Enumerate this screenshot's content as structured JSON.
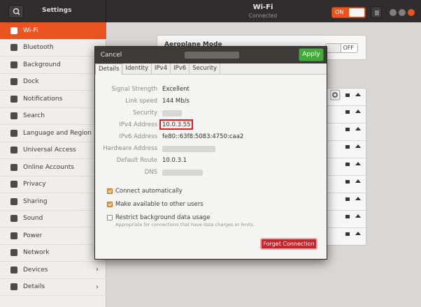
{
  "header": {
    "app_title": "Settings",
    "window_title": "Wi-Fi",
    "window_subtitle": "Connected",
    "wifi_toggle_label": "ON",
    "accent": "#e95420"
  },
  "sidebar": {
    "items": [
      {
        "label": "Wi-Fi",
        "icon": "wifi-icon",
        "active": true
      },
      {
        "label": "Bluetooth",
        "icon": "bluetooth-icon"
      },
      {
        "label": "Background",
        "icon": "background-icon"
      },
      {
        "label": "Dock",
        "icon": "dock-icon"
      },
      {
        "label": "Notifications",
        "icon": "bell-icon"
      },
      {
        "label": "Search",
        "icon": "search-icon"
      },
      {
        "label": "Language and Region",
        "icon": "language-icon"
      },
      {
        "label": "Universal Access",
        "icon": "accessibility-icon"
      },
      {
        "label": "Online Accounts",
        "icon": "cloud-icon"
      },
      {
        "label": "Privacy",
        "icon": "hand-icon"
      },
      {
        "label": "Sharing",
        "icon": "share-icon"
      },
      {
        "label": "Sound",
        "icon": "speaker-icon"
      },
      {
        "label": "Power",
        "icon": "power-icon"
      },
      {
        "label": "Network",
        "icon": "network-icon"
      },
      {
        "label": "Devices",
        "icon": "devices-icon",
        "chevron": "›"
      },
      {
        "label": "Details",
        "icon": "info-icon",
        "chevron": "›"
      }
    ]
  },
  "main": {
    "aeroplane_mode_label": "Aeroplane Mode",
    "aeroplane_toggle_label": "OFF"
  },
  "dialog": {
    "cancel_label": "Cancel",
    "apply_label": "Apply",
    "tabs": [
      "Details",
      "Identity",
      "IPv4",
      "IPv6",
      "Security"
    ],
    "details": [
      {
        "label": "Signal Strength",
        "value": "Excellent"
      },
      {
        "label": "Link speed",
        "value": "144 Mb/s"
      },
      {
        "label": "Security",
        "value": ""
      },
      {
        "label": "IPv4 Address",
        "value": "10.0.3.55"
      },
      {
        "label": "IPv6 Address",
        "value": "fe80::63f8:5083:4750:caa2"
      },
      {
        "label": "Hardware Address",
        "value": ""
      },
      {
        "label": "Default Route",
        "value": "10.0.3.1"
      },
      {
        "label": "DNS",
        "value": ""
      }
    ],
    "options": {
      "connect_auto": "Connect automatically",
      "available_others": "Make available to other users",
      "restrict_bg": "Restrict background data usage",
      "restrict_hint": "Appropriate for connections that have data charges or limits."
    },
    "forget_label": "Forget Connection"
  }
}
